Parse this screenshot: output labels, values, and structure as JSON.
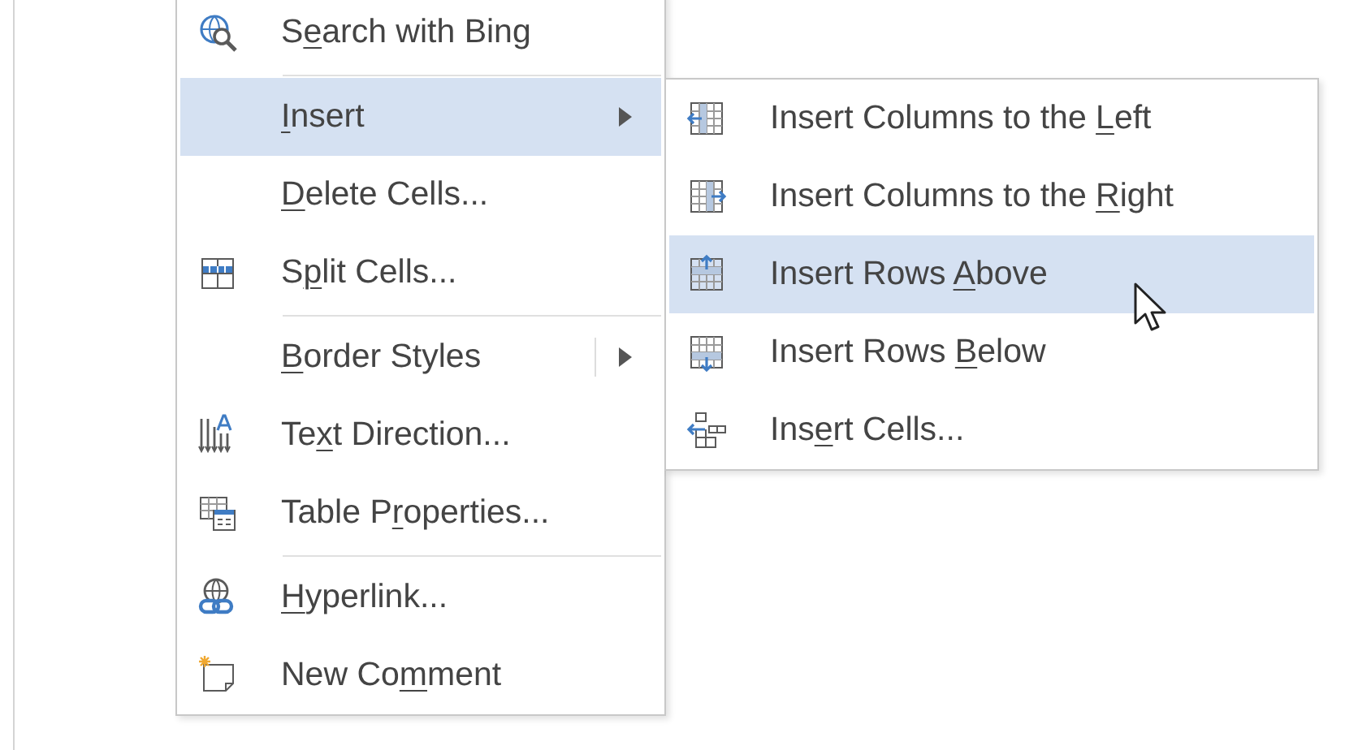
{
  "context_menu": {
    "items": [
      {
        "kind": "command",
        "label": {
          "before": "S",
          "key": "e",
          "after": "arch with Bing"
        },
        "selected": false
      },
      {
        "kind": "separator"
      },
      {
        "kind": "submenu",
        "label": {
          "key": "I",
          "after": "nsert"
        },
        "selected": true
      },
      {
        "kind": "command",
        "label": {
          "key": "D",
          "after": "elete Cells..."
        },
        "selected": false
      },
      {
        "kind": "command",
        "label": {
          "before": "S",
          "key": "p",
          "after": "lit Cells..."
        },
        "selected": false
      },
      {
        "kind": "separator"
      },
      {
        "kind": "split-submenu",
        "label": {
          "key": "B",
          "after": "order Styles"
        },
        "selected": false
      },
      {
        "kind": "command",
        "label": {
          "before": "Te",
          "key": "x",
          "after": "t Direction..."
        },
        "selected": false
      },
      {
        "kind": "command",
        "label": {
          "before": "Table P",
          "key": "r",
          "after": "operties..."
        },
        "selected": false
      },
      {
        "kind": "separator"
      },
      {
        "kind": "command",
        "label": {
          "key": "H",
          "after": "yperlink..."
        },
        "selected": false
      },
      {
        "kind": "command",
        "label": {
          "before": "New Co",
          "key": "m",
          "after": "ment"
        },
        "selected": false
      }
    ]
  },
  "insert_submenu": {
    "items": [
      {
        "label": {
          "before": "Insert Columns to the ",
          "key": "L",
          "after": "eft"
        },
        "selected": false
      },
      {
        "label": {
          "before": "Insert Columns to the ",
          "key": "R",
          "after": "ight"
        },
        "selected": false
      },
      {
        "label": {
          "before": "Insert Rows ",
          "key": "A",
          "after": "bove"
        },
        "selected": true
      },
      {
        "label": {
          "before": "Insert Rows ",
          "key": "B",
          "after": "elow"
        },
        "selected": false
      },
      {
        "label": {
          "before": "Ins",
          "key": "e",
          "after": "rt Cells..."
        },
        "selected": false
      }
    ]
  }
}
